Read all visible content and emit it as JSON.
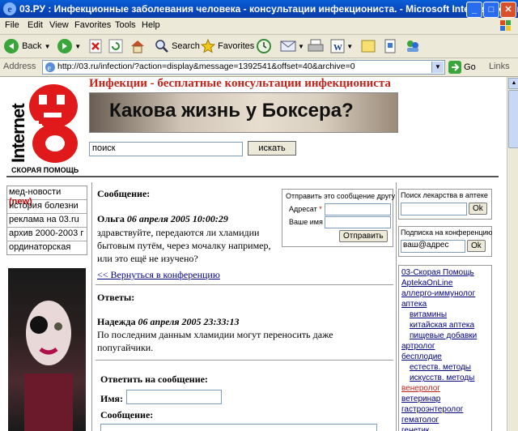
{
  "window": {
    "title": "03.РУ : Инфекционные заболевания человека - консультации инфекциониста. - Microsoft Internet Explorer"
  },
  "menu": [
    "File",
    "Edit",
    "View",
    "Favorites",
    "Tools",
    "Help"
  ],
  "toolbar": {
    "back": "Back",
    "search": "Search",
    "favorites": "Favorites"
  },
  "address": {
    "label": "Address",
    "url": "http://03.ru/infection/?action=display&message=1392541&offset=40&archive=0",
    "go": "Go",
    "links": "Links"
  },
  "site": {
    "logo_text": "Internet",
    "logo_sub": "СКОРАЯ ПОМОЩЬ",
    "heading": "Инфекции - бесплатные консультации инфекциониста",
    "banner": "Какова жизнь у Боксера?",
    "search_value": "поиск",
    "search_button": "искать"
  },
  "left_nav": [
    {
      "label": "мед-новости",
      "badge": "(new)"
    },
    {
      "label": "история болезни"
    },
    {
      "label": "реклама на 03.ru"
    },
    {
      "label": "архив 2000-2003 г"
    },
    {
      "label": "ординаторская"
    }
  ],
  "message": {
    "section_label": "Сообщение:",
    "author": "Ольга",
    "date": "06 апреля 2005 10:00:29",
    "text": "здравствуйте, передаются ли хламидии бытовым путём, через мочалку например, или это ещё не изучено?",
    "back_link": "<< Вернуться в конференцию"
  },
  "send_friend": {
    "title": "Отправить это сообщение другу",
    "to_label": "Адресат",
    "required": "*",
    "name_label": "Ваше имя",
    "button": "Отправить"
  },
  "replies": {
    "label": "Ответы:",
    "items": [
      {
        "author": "Надежда",
        "date": "06 апреля 2005 23:33:13",
        "text": "По последним данным хламидии могут переносить даже попугайчики."
      }
    ]
  },
  "reply_form": {
    "title": "Ответить на сообщение:",
    "name_label": "Имя:",
    "message_label": "Сообщение:"
  },
  "drug_search": {
    "title": "Поиск лекарства в аптеке",
    "button": "Ok"
  },
  "subscribe": {
    "title": "Подписка на конференцию",
    "value": "ваш@адрес",
    "button": "Ok"
  },
  "right_nav": [
    {
      "label": "03-Скорая Помощь",
      "indent": 0,
      "red": false
    },
    {
      "label": "AptekaOnLine",
      "indent": 0,
      "red": false
    },
    {
      "label": "аллерго-иммунолог",
      "indent": 0,
      "red": false
    },
    {
      "label": "аптека",
      "indent": 0,
      "red": false
    },
    {
      "label": "витамины",
      "indent": 1,
      "red": false
    },
    {
      "label": "китайская аптека",
      "indent": 1,
      "red": false
    },
    {
      "label": "пищевые добавки",
      "indent": 1,
      "red": false
    },
    {
      "label": "артролог",
      "indent": 0,
      "red": false
    },
    {
      "label": "бесплодие",
      "indent": 0,
      "red": false
    },
    {
      "label": "естеств. методы",
      "indent": 1,
      "red": false
    },
    {
      "label": "искусств. методы",
      "indent": 1,
      "red": false
    },
    {
      "label": "венеролог",
      "indent": 0,
      "red": true
    },
    {
      "label": "ветеринар",
      "indent": 0,
      "red": false
    },
    {
      "label": "гастроэнтеролог",
      "indent": 0,
      "red": false
    },
    {
      "label": "гематолог",
      "indent": 0,
      "red": false
    },
    {
      "label": "генетик",
      "indent": 0,
      "red": false
    }
  ]
}
